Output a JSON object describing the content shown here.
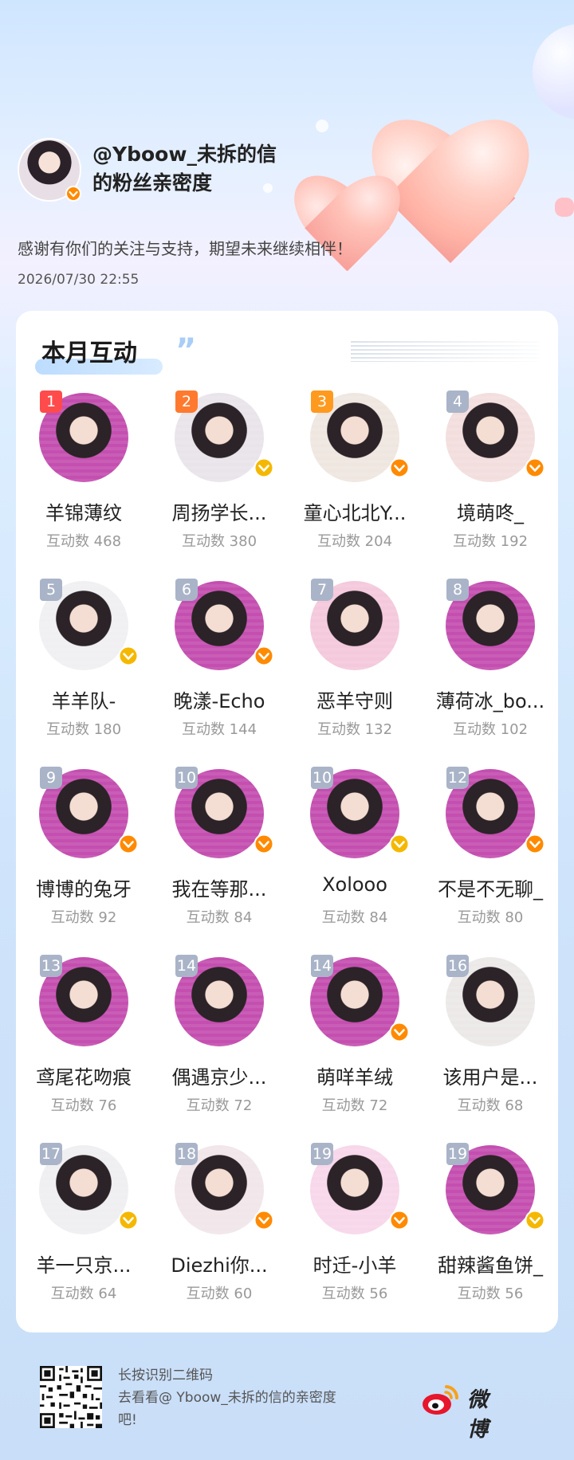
{
  "header": {
    "owner_handle": "@Yboow_未拆的信",
    "title_suffix": "的粉丝亲密度",
    "thanks": "感谢有你们的关注与支持，期望未来继续相伴！",
    "datetime": "2026/07/30 22:55"
  },
  "section": {
    "title": "本月互动",
    "quote": "”"
  },
  "fans": [
    {
      "rank": "1",
      "name": "羊锦薄纹",
      "count": "互动数 468",
      "verified": false,
      "rank_color": "#ff4b4b",
      "avatar_bg": "#c44fb0"
    },
    {
      "rank": "2",
      "name": "周扬学长...",
      "count": "互动数 380",
      "verified": true,
      "rank_color": "#ff7a2e",
      "avatar_bg": "#e9e4ea"
    },
    {
      "rank": "3",
      "name": "童心北北Y...",
      "count": "互动数 204",
      "verified": true,
      "rank_color": "#ff9a1f",
      "avatar_bg": "#efe6e0"
    },
    {
      "rank": "4",
      "name": "境萌咚_",
      "count": "互动数 192",
      "verified": true,
      "rank_color": "#aab4c8",
      "avatar_bg": "#f3dede"
    },
    {
      "rank": "5",
      "name": "羊羊队-",
      "count": "互动数 180",
      "verified": true,
      "rank_color": "#aab4c8",
      "avatar_bg": "#f0f0f2"
    },
    {
      "rank": "6",
      "name": "晚漾-Echo",
      "count": "互动数 144",
      "verified": true,
      "rank_color": "#aab4c8",
      "avatar_bg": "#c44fb0"
    },
    {
      "rank": "7",
      "name": "恶羊守则",
      "count": "互动数 132",
      "verified": false,
      "rank_color": "#aab4c8",
      "avatar_bg": "#f4c9dc"
    },
    {
      "rank": "8",
      "name": "薄荷冰_bo...",
      "count": "互动数 102",
      "verified": false,
      "rank_color": "#aab4c8",
      "avatar_bg": "#c44fb0"
    },
    {
      "rank": "9",
      "name": "博博的兔牙",
      "count": "互动数 92",
      "verified": true,
      "rank_color": "#aab4c8",
      "avatar_bg": "#c44fb0"
    },
    {
      "rank": "10",
      "name": "我在等那...",
      "count": "互动数 84",
      "verified": true,
      "rank_color": "#aab4c8",
      "avatar_bg": "#c44fb0"
    },
    {
      "rank": "10",
      "name": "Xolooo",
      "count": "互动数 84",
      "verified": true,
      "rank_color": "#aab4c8",
      "avatar_bg": "#c44fb0"
    },
    {
      "rank": "12",
      "name": "不是不无聊_",
      "count": "互动数 80",
      "verified": true,
      "rank_color": "#aab4c8",
      "avatar_bg": "#c44fb0"
    },
    {
      "rank": "13",
      "name": "鸢尾花吻痕",
      "count": "互动数 76",
      "verified": false,
      "rank_color": "#aab4c8",
      "avatar_bg": "#c44fb0"
    },
    {
      "rank": "14",
      "name": "偶遇京少...",
      "count": "互动数 72",
      "verified": false,
      "rank_color": "#aab4c8",
      "avatar_bg": "#c44fb0"
    },
    {
      "rank": "14",
      "name": "萌咩羊绒",
      "count": "互动数 72",
      "verified": true,
      "rank_color": "#aab4c8",
      "avatar_bg": "#c44fb0"
    },
    {
      "rank": "16",
      "name": "该用户是...",
      "count": "互动数 68",
      "verified": false,
      "rank_color": "#aab4c8",
      "avatar_bg": "#ece8e8"
    },
    {
      "rank": "17",
      "name": "羊一只京...",
      "count": "互动数 64",
      "verified": true,
      "rank_color": "#aab4c8",
      "avatar_bg": "#efeff2"
    },
    {
      "rank": "18",
      "name": "Diezhi你...",
      "count": "互动数 60",
      "verified": true,
      "rank_color": "#aab4c8",
      "avatar_bg": "#f1e6ea"
    },
    {
      "rank": "19",
      "name": "时迁-小羊",
      "count": "互动数 56",
      "verified": true,
      "rank_color": "#aab4c8",
      "avatar_bg": "#f7d7ea"
    },
    {
      "rank": "19",
      "name": "甜辣酱鱼饼_",
      "count": "互动数 56",
      "verified": true,
      "rank_color": "#aab4c8",
      "avatar_bg": "#c44fb0"
    }
  ],
  "footer": {
    "line1": "长按识别二维码",
    "line2": "去看看@ Yboow_未拆的信的亲密度",
    "line3": "吧!",
    "brand": "微博"
  },
  "colors": {
    "verified_badge": "#ff8a00",
    "verified_badge_alt": "#f5b800"
  }
}
